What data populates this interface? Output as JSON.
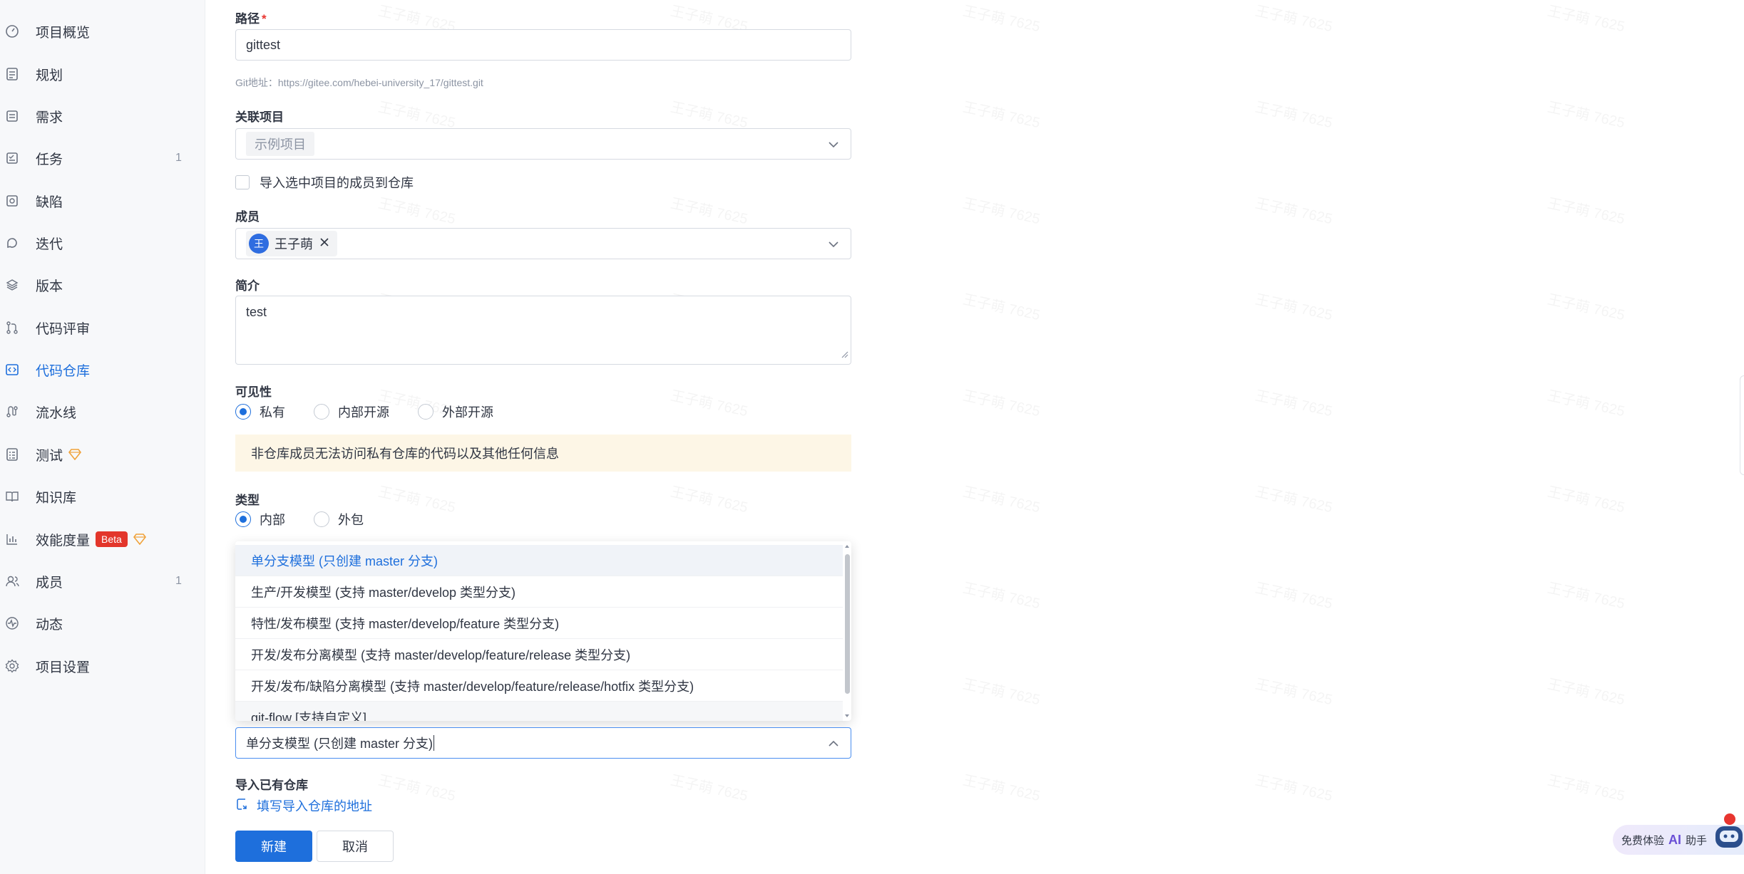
{
  "sidebar": {
    "items": [
      {
        "label": "项目概览",
        "icon": "dashboard-icon"
      },
      {
        "label": "规划",
        "icon": "plan-icon"
      },
      {
        "label": "需求",
        "icon": "requirement-icon"
      },
      {
        "label": "任务",
        "icon": "task-icon",
        "count": "1"
      },
      {
        "label": "缺陷",
        "icon": "bug-icon"
      },
      {
        "label": "迭代",
        "icon": "iteration-icon"
      },
      {
        "label": "版本",
        "icon": "layers-icon"
      },
      {
        "label": "代码评审",
        "icon": "merge-icon"
      },
      {
        "label": "代码仓库",
        "icon": "code-icon",
        "active": true
      },
      {
        "label": "流水线",
        "icon": "pipeline-icon"
      },
      {
        "label": "测试",
        "icon": "test-icon"
      },
      {
        "label": "知识库",
        "icon": "book-icon"
      },
      {
        "label": "效能度量",
        "icon": "chart-icon",
        "badge": "Beta"
      },
      {
        "label": "成员",
        "icon": "people-icon",
        "count": "1"
      },
      {
        "label": "动态",
        "icon": "activity-icon"
      },
      {
        "label": "项目设置",
        "icon": "settings-icon"
      }
    ]
  },
  "form": {
    "path": {
      "label": "路径",
      "required": "*",
      "value": "gittest",
      "hint": "Git地址：https://gitee.com/hebei-university_17/gittest.git"
    },
    "project": {
      "label": "关联项目",
      "placeholder": "示例项目"
    },
    "import_members": {
      "label": "导入选中项目的成员到仓库"
    },
    "members": {
      "label": "成员",
      "member_name": "王子萌",
      "avatar_text": "王"
    },
    "intro": {
      "label": "简介",
      "value": "test"
    },
    "visibility": {
      "label": "可见性",
      "options": [
        "私有",
        "内部开源",
        "外部开源"
      ],
      "selected": "私有",
      "notice": "非仓库成员无法访问私有仓库的代码以及其他任何信息"
    },
    "type": {
      "label": "类型",
      "options": [
        "内部",
        "外包"
      ],
      "selected": "内部"
    },
    "branch_model": {
      "options": [
        "单分支模型 (只创建 master 分支)",
        "生产/开发模型 (支持 master/develop 类型分支)",
        "特性/发布模型 (支持 master/develop/feature 类型分支)",
        "开发/发布分离模型 (支持 master/develop/feature/release 类型分支)",
        "开发/发布/缺陷分离模型 (支持 master/develop/feature/release/hotfix 类型分支)",
        "git-flow [支持自定义]"
      ],
      "selected": "单分支模型 (只创建 master 分支)"
    },
    "import_repo": {
      "label": "导入已有仓库",
      "link": "填写导入仓库的地址"
    },
    "submit_label": "新建",
    "cancel_label": "取消"
  },
  "ai_widget": {
    "prefix": "免费体验",
    "ai": "AI",
    "suffix": "助手"
  },
  "watermark_text": "王子萌 7625",
  "colors": {
    "accent": "#1e6fdc",
    "required": "#e8352f",
    "notice_bg": "#fdf6e6",
    "beta": "#e3362b"
  }
}
